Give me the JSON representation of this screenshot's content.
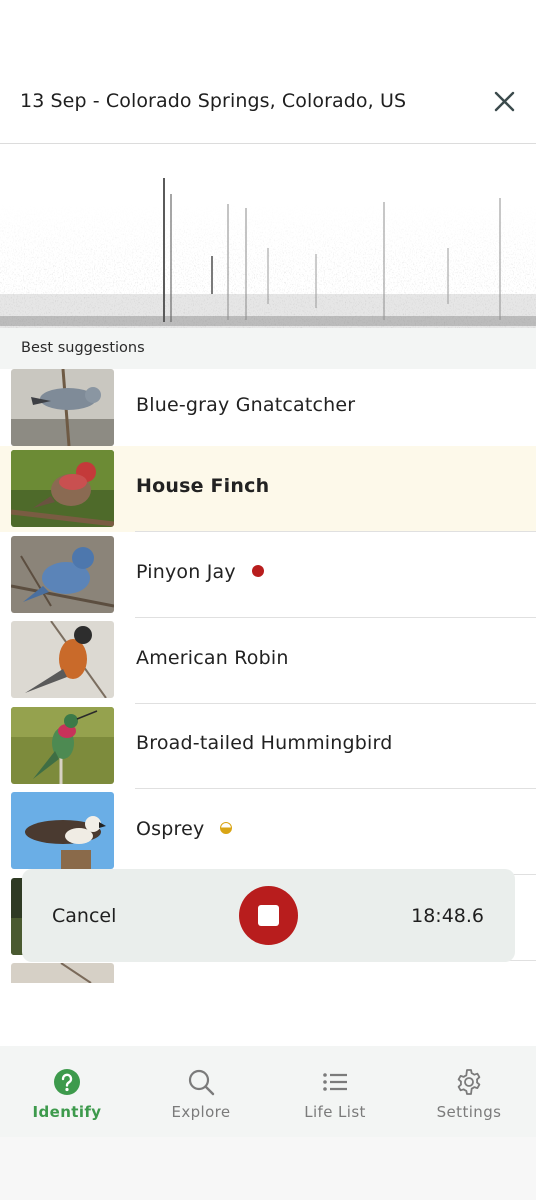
{
  "header": {
    "title": "13 Sep - Colorado Springs, Colorado, US",
    "close_icon": "close-icon"
  },
  "suggestions": {
    "section_label": "Best suggestions",
    "items": [
      {
        "name": "Blue-gray Gnatcatcher",
        "selected": false,
        "badge": null
      },
      {
        "name": "House Finch",
        "selected": true,
        "badge": null
      },
      {
        "name": "Pinyon Jay",
        "selected": false,
        "badge": "red-dot",
        "badge_color": "#b81d1d"
      },
      {
        "name": "American Robin",
        "selected": false,
        "badge": null
      },
      {
        "name": "Broad-tailed Hummingbird",
        "selected": false,
        "badge": null
      },
      {
        "name": "Osprey",
        "selected": false,
        "badge": "half-circle",
        "badge_color": "#d9a515"
      }
    ]
  },
  "recording": {
    "cancel_label": "Cancel",
    "elapsed": "18:48.6",
    "stop_icon": "stop-icon"
  },
  "tabs": [
    {
      "label": "Identify",
      "icon": "question-circle-icon",
      "active": true
    },
    {
      "label": "Explore",
      "icon": "search-icon",
      "active": false
    },
    {
      "label": "Life List",
      "icon": "list-icon",
      "active": false
    },
    {
      "label": "Settings",
      "icon": "gear-icon",
      "active": false
    }
  ],
  "colors": {
    "accent_green": "#3d9a4c",
    "record_red": "#b81d1d",
    "selected_row": "#fdf9ea"
  }
}
